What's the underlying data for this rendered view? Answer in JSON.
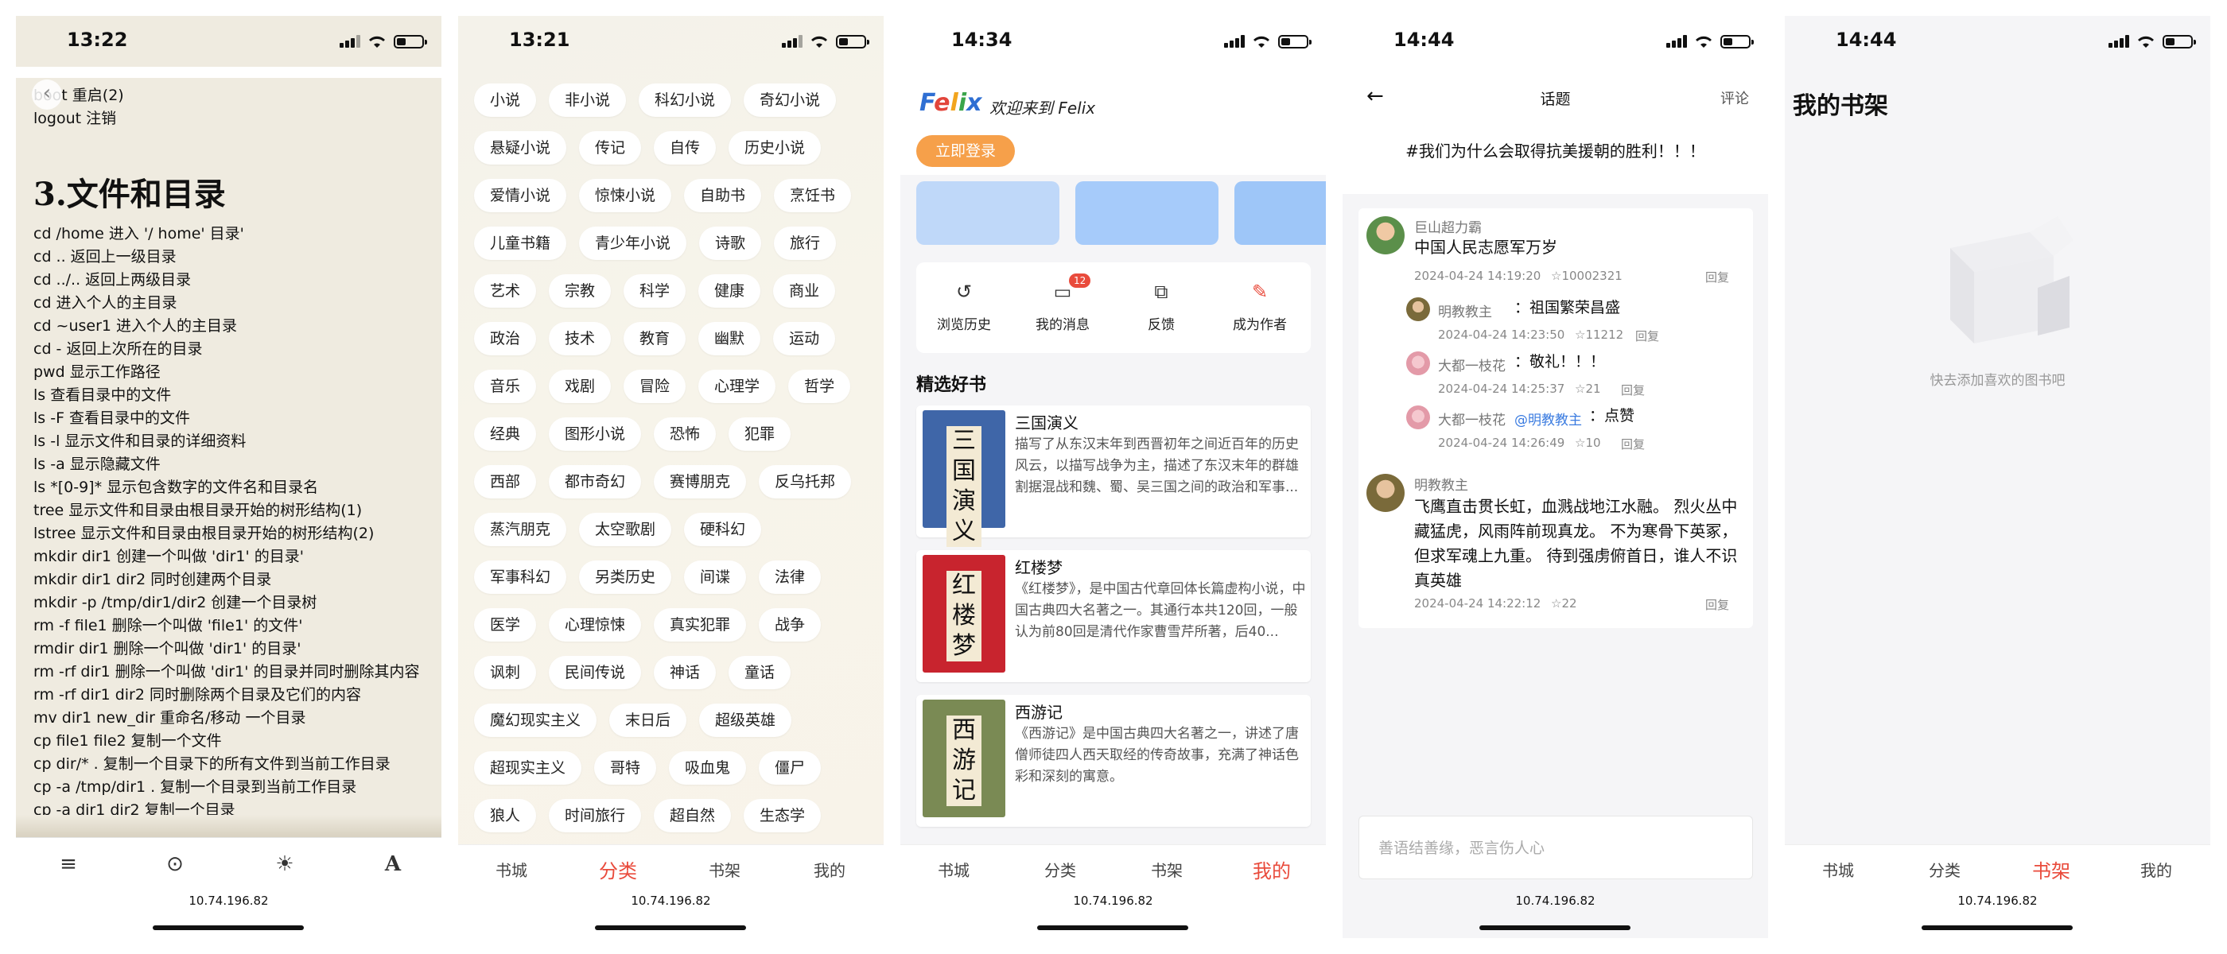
{
  "screens": {
    "reader": {
      "time": "13:22",
      "lines_top": [
        "boot 重启(2)",
        "logout 注销"
      ],
      "heading": "3.文件和目录",
      "lines": [
        "cd /home 进入 '/ home' 目录'",
        "cd .. 返回上一级目录",
        "cd ../.. 返回上两级目录",
        "cd 进入个人的主目录",
        "cd ~user1 进入个人的主目录",
        "cd - 返回上次所在的目录",
        "pwd 显示工作路径",
        "ls 查看目录中的文件",
        "ls -F 查看目录中的文件",
        "ls -l 显示文件和目录的详细资料",
        "ls -a 显示隐藏文件",
        "ls *[0-9]* 显示包含数字的文件名和目录名",
        "tree 显示文件和目录由根目录开始的树形结构(1)",
        "lstree 显示文件和目录由根目录开始的树形结构(2)",
        "mkdir dir1 创建一个叫做 'dir1' 的目录'",
        "mkdir dir1 dir2 同时创建两个目录",
        "mkdir -p /tmp/dir1/dir2 创建一个目录树",
        "rm -f file1 删除一个叫做 'file1' 的文件'",
        "rmdir dir1 删除一个叫做 'dir1' 的目录'",
        "rm -rf dir1 删除一个叫做 'dir1' 的目录并同时删除其内容",
        "rm -rf dir1 dir2 同时删除两个目录及它们的内容",
        "mv dir1 new_dir 重命名/移动 一个目录",
        "cp file1 file2 复制一个文件",
        "cp dir/* . 复制一个目录下的所有文件到当前工作目录",
        "cp -a /tmp/dir1 . 复制一个目录到当前工作目录",
        "cp -a dir1 dir2 复制一个目录"
      ],
      "toolbar": {
        "menu": "≡",
        "brightness_low": "⊙",
        "brightness": "☀",
        "font": "A"
      },
      "address": "10.74.196.82"
    },
    "categories": {
      "time": "13:21",
      "rows": [
        [
          "小说",
          "非小说",
          "科幻小说",
          "奇幻小说"
        ],
        [
          "悬疑小说",
          "传记",
          "自传",
          "历史小说"
        ],
        [
          "爱情小说",
          "惊悚小说",
          "自助书",
          "烹饪书"
        ],
        [
          "儿童书籍",
          "青少年小说",
          "诗歌",
          "旅行"
        ],
        [
          "艺术",
          "宗教",
          "科学",
          "健康",
          "商业"
        ],
        [
          "政治",
          "技术",
          "教育",
          "幽默",
          "运动"
        ],
        [
          "音乐",
          "戏剧",
          "冒险",
          "心理学",
          "哲学"
        ],
        [
          "经典",
          "图形小说",
          "恐怖",
          "犯罪"
        ],
        [
          "西部",
          "都市奇幻",
          "赛博朋克",
          "反乌托邦"
        ],
        [
          "蒸汽朋克",
          "太空歌剧",
          "硬科幻"
        ],
        [
          "军事科幻",
          "另类历史",
          "间谍",
          "法律"
        ],
        [
          "医学",
          "心理惊悚",
          "真实犯罪",
          "战争"
        ],
        [
          "讽刺",
          "民间传说",
          "神话",
          "童话"
        ],
        [
          "魔幻现实主义",
          "末日后",
          "超级英雄"
        ],
        [
          "超现实主义",
          "哥特",
          "吸血鬼",
          "僵尸"
        ],
        [
          "狼人",
          "时间旅行",
          "超自然",
          "生态学"
        ]
      ],
      "tabs": [
        "书城",
        "分类",
        "书架",
        "我的"
      ],
      "active_tab": "分类",
      "address": "10.74.196.82"
    },
    "profile": {
      "time": "14:34",
      "logo_letters": [
        "F",
        "e",
        "l",
        "i",
        "x"
      ],
      "welcome": "欢迎来到 Felix",
      "login": "立即登录",
      "menu": [
        {
          "icon": "history-icon",
          "glyph": "↺",
          "label": "浏览历史"
        },
        {
          "icon": "message-icon",
          "glyph": "▭",
          "label": "我的消息",
          "badge": "12"
        },
        {
          "icon": "feedback-icon",
          "glyph": "⧉",
          "label": "反馈"
        },
        {
          "icon": "edit-icon",
          "glyph": "✎",
          "label": "成为作者"
        }
      ],
      "section_title": "精选好书",
      "books": [
        {
          "title": "三国演义",
          "desc": "描写了从东汉末年到西晋初年之间近百年的历史风云，以描写战争为主，描述了东汉末年的群雄割据混战和魏、蜀、吴三国之间的政治和军事...",
          "cover_text": "三国演义",
          "cover_color": "#3f66a8"
        },
        {
          "title": "红楼梦",
          "desc": "《红楼梦》，是中国古代章回体长篇虚构小说，中国古典四大名著之一。其通行本共120回，一般认为前80回是清代作家曹雪芹所著，后40...",
          "cover_text": "红楼梦",
          "cover_color": "#c8242e"
        },
        {
          "title": "西游记",
          "desc": "《西游记》是中国古典四大名著之一，讲述了唐僧师徒四人西天取经的传奇故事，充满了神话色彩和深刻的寓意。",
          "cover_text": "西游记",
          "cover_color": "#7a8a54"
        }
      ],
      "tabs": [
        "书城",
        "分类",
        "书架",
        "我的"
      ],
      "active_tab": "我的",
      "address": "10.74.196.82"
    },
    "topic": {
      "time": "14:44",
      "header": "话题",
      "comment_link": "评论",
      "topic": "#我们为什么会取得抗美援朝的胜利！！！",
      "comments": [
        {
          "user": "巨山超力霸",
          "text": "中国人民志愿军万岁",
          "time": "2024-04-24 14:19:20",
          "likes": "☆10002321",
          "reply": "回复"
        },
        {
          "user": "明教教主",
          "text": "：祖国繁荣昌盛",
          "time": "2024-04-24 14:23:50",
          "likes": "☆11212",
          "reply": "回复"
        },
        {
          "user": "大都一枝花",
          "text": "：敬礼！！！",
          "time": "2024-04-24 14:25:37",
          "likes": "☆21",
          "reply": "回复"
        },
        {
          "user": "大都一枝花",
          "mention": "@明教教主",
          "text": "：点赞",
          "time": "2024-04-24 14:26:49",
          "likes": "☆10",
          "reply": "回复"
        },
        {
          "user": "明教教主",
          "text": "飞鹰直击贯长虹，血溅战地江水融。 烈火丛中藏猛虎，风雨阵前现真龙。 不为寒骨下英冢，但求军魂上九重。 待到强虏俯首日，谁人不识真英雄",
          "time": "2024-04-24 14:22:12",
          "likes": "☆22",
          "reply": "回复"
        }
      ],
      "input_placeholder": "善语结善缘，恶言伤人心",
      "address": "10.74.196.82"
    },
    "shelf": {
      "time": "14:44",
      "title": "我的书架",
      "empty": "快去添加喜欢的图书吧",
      "tabs": [
        "书城",
        "分类",
        "书架",
        "我的"
      ],
      "active_tab": "书架",
      "address": "10.74.196.82"
    }
  }
}
